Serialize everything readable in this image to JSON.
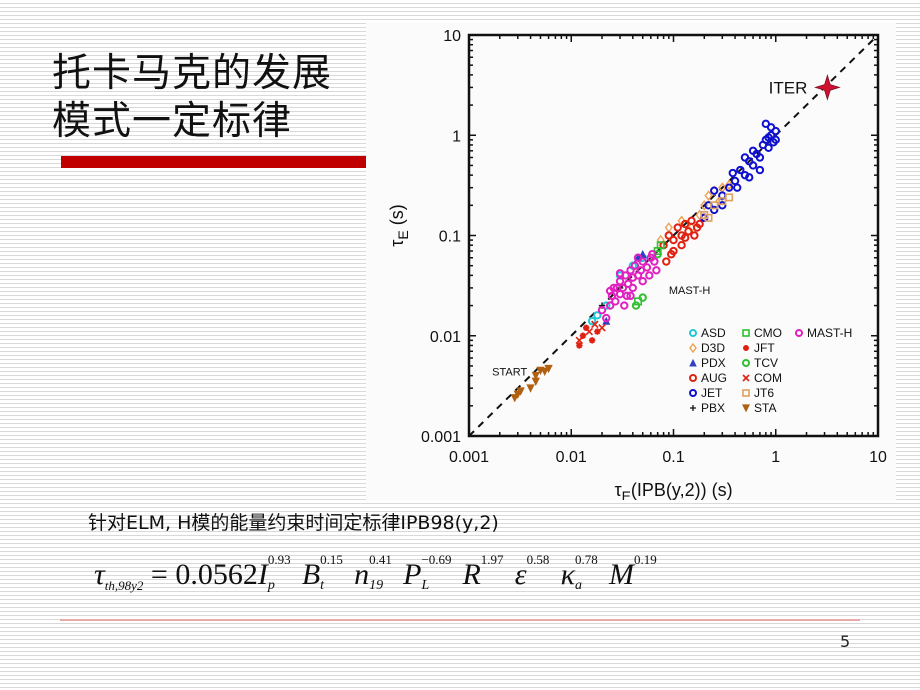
{
  "slide": {
    "title_line1": "托卡马克的发展",
    "title_line2": "模式一定标律",
    "accent_color": "#c00000",
    "subtitle": "针对ELM, H模的能量约束时间定标律IPB98(y,2)",
    "page_number": "5",
    "formula": {
      "lhs_symbol": "τ",
      "lhs_subscript": "th,98y2",
      "equals": "=",
      "coefficient": "0.0562",
      "terms": [
        {
          "base": "I",
          "sub": "p",
          "exp": "0.93"
        },
        {
          "base": "B",
          "sub": "t",
          "exp": "0.15"
        },
        {
          "base": "n",
          "sub": "19",
          "exp": "0.41"
        },
        {
          "base": "P",
          "sub": "L",
          "exp": "−0.69"
        },
        {
          "base": "R",
          "sub": "",
          "exp": "1.97"
        },
        {
          "base": "ε",
          "sub": "",
          "exp": "0.58"
        },
        {
          "base": "κ",
          "sub": "a",
          "exp": "0.78"
        },
        {
          "base": "M",
          "sub": "",
          "exp": "0.19"
        }
      ]
    }
  },
  "chart_data": {
    "type": "scatter",
    "title": "",
    "xlabel": "τE(IPB(y,2)) (s)",
    "ylabel": "τE (s)",
    "xscale": "log",
    "yscale": "log",
    "xlim": [
      0.001,
      10
    ],
    "ylim": [
      0.001,
      10
    ],
    "x_ticks": [
      "0.001",
      "0.01",
      "0.1",
      "1",
      "10"
    ],
    "y_ticks": [
      "0.001",
      "0.01",
      "0.1",
      "1",
      "10"
    ],
    "grid": false,
    "reference_line": {
      "style": "dashed",
      "equation": "y = x",
      "color": "#111111"
    },
    "legend_position": "bottom-right",
    "annotations": [
      {
        "text": "ITER",
        "x": 3.2,
        "y": 3.0
      },
      {
        "text": "MAST-H",
        "x": 0.09,
        "y": 0.026
      },
      {
        "text": "START",
        "x": 0.0025,
        "y": 0.004
      }
    ],
    "series": [
      {
        "name": "ASD",
        "color": "#22c8d8",
        "marker": "circle",
        "points": [
          [
            0.016,
            0.014
          ],
          [
            0.018,
            0.016
          ],
          [
            0.03,
            0.04
          ],
          [
            0.04,
            0.05
          ],
          [
            0.05,
            0.06
          ],
          [
            0.022,
            0.02
          ]
        ]
      },
      {
        "name": "D3D",
        "color": "#f0a050",
        "marker": "diamond",
        "points": [
          [
            0.075,
            0.09
          ],
          [
            0.09,
            0.12
          ],
          [
            0.12,
            0.14
          ],
          [
            0.15,
            0.12
          ],
          [
            0.2,
            0.2
          ],
          [
            0.25,
            0.28
          ],
          [
            0.3,
            0.3
          ],
          [
            0.35,
            0.32
          ],
          [
            0.18,
            0.16
          ],
          [
            0.22,
            0.25
          ],
          [
            0.28,
            0.22
          ]
        ]
      },
      {
        "name": "PDX",
        "color": "#3040c0",
        "marker": "triangle",
        "points": [
          [
            0.045,
            0.06
          ],
          [
            0.05,
            0.065
          ],
          [
            0.022,
            0.014
          ]
        ]
      },
      {
        "name": "AUG",
        "color": "#e02010",
        "marker": "circle",
        "points": [
          [
            0.08,
            0.08
          ],
          [
            0.09,
            0.1
          ],
          [
            0.1,
            0.09
          ],
          [
            0.11,
            0.12
          ],
          [
            0.12,
            0.1
          ],
          [
            0.13,
            0.13
          ],
          [
            0.14,
            0.11
          ],
          [
            0.15,
            0.14
          ],
          [
            0.17,
            0.12
          ],
          [
            0.1,
            0.07
          ],
          [
            0.12,
            0.08
          ],
          [
            0.16,
            0.1
          ],
          [
            0.2,
            0.15
          ],
          [
            0.085,
            0.055
          ],
          [
            0.095,
            0.065
          ],
          [
            0.13,
            0.095
          ],
          [
            0.18,
            0.13
          ]
        ]
      },
      {
        "name": "JET",
        "color": "#1010d0",
        "marker": "circle",
        "points": [
          [
            0.2,
            0.15
          ],
          [
            0.22,
            0.2
          ],
          [
            0.25,
            0.18
          ],
          [
            0.3,
            0.25
          ],
          [
            0.35,
            0.3
          ],
          [
            0.4,
            0.35
          ],
          [
            0.45,
            0.45
          ],
          [
            0.5,
            0.4
          ],
          [
            0.55,
            0.55
          ],
          [
            0.6,
            0.5
          ],
          [
            0.65,
            0.65
          ],
          [
            0.7,
            0.6
          ],
          [
            0.75,
            0.8
          ],
          [
            0.8,
            0.9
          ],
          [
            0.85,
            0.75
          ],
          [
            0.9,
            1.0
          ],
          [
            0.95,
            0.85
          ],
          [
            1.0,
            1.1
          ],
          [
            0.9,
            1.2
          ],
          [
            0.8,
            1.3
          ],
          [
            0.3,
            0.2
          ],
          [
            0.42,
            0.3
          ],
          [
            0.5,
            0.6
          ],
          [
            0.6,
            0.7
          ],
          [
            0.7,
            0.45
          ],
          [
            0.25,
            0.28
          ],
          [
            0.38,
            0.42
          ],
          [
            0.85,
            0.95
          ],
          [
            1.0,
            0.9
          ],
          [
            0.55,
            0.38
          ]
        ]
      },
      {
        "name": "PBX",
        "color": "#111111",
        "marker": "plus",
        "points": [
          [
            0.02,
            0.02
          ],
          [
            0.03,
            0.03
          ]
        ]
      },
      {
        "name": "CMO",
        "color": "#30c030",
        "marker": "square",
        "points": [
          [
            0.07,
            0.07
          ],
          [
            0.075,
            0.08
          ],
          [
            0.045,
            0.022
          ]
        ]
      },
      {
        "name": "JFT",
        "color": "#e02010",
        "marker": "asterisk",
        "points": [
          [
            0.012,
            0.008
          ],
          [
            0.013,
            0.01
          ],
          [
            0.014,
            0.012
          ],
          [
            0.016,
            0.009
          ],
          [
            0.018,
            0.011
          ]
        ]
      },
      {
        "name": "TCV",
        "color": "#30c030",
        "marker": "circle",
        "points": [
          [
            0.043,
            0.02
          ],
          [
            0.05,
            0.024
          ],
          [
            0.07,
            0.065
          ]
        ]
      },
      {
        "name": "COM",
        "color": "#e02010",
        "marker": "x",
        "points": [
          [
            0.012,
            0.009
          ],
          [
            0.015,
            0.011
          ],
          [
            0.02,
            0.012
          ],
          [
            0.017,
            0.013
          ]
        ]
      },
      {
        "name": "JT6",
        "color": "#e0a060",
        "marker": "square",
        "points": [
          [
            0.2,
            0.16
          ],
          [
            0.25,
            0.2
          ],
          [
            0.3,
            0.22
          ],
          [
            0.35,
            0.24
          ],
          [
            0.22,
            0.15
          ]
        ]
      },
      {
        "name": "STA",
        "color": "#b06010",
        "marker": "triangle-down",
        "points": [
          [
            0.0028,
            0.0024
          ],
          [
            0.003,
            0.0026
          ],
          [
            0.0032,
            0.0028
          ],
          [
            0.004,
            0.003
          ],
          [
            0.0045,
            0.0035
          ],
          [
            0.005,
            0.0045
          ],
          [
            0.0055,
            0.0044
          ],
          [
            0.006,
            0.0047
          ],
          [
            0.0045,
            0.004
          ]
        ]
      },
      {
        "name": "MAST-H",
        "color": "#e020c0",
        "marker": "circle",
        "points": [
          [
            0.02,
            0.018
          ],
          [
            0.022,
            0.015
          ],
          [
            0.024,
            0.02
          ],
          [
            0.025,
            0.025
          ],
          [
            0.027,
            0.022
          ],
          [
            0.028,
            0.03
          ],
          [
            0.03,
            0.026
          ],
          [
            0.03,
            0.035
          ],
          [
            0.032,
            0.03
          ],
          [
            0.034,
            0.04
          ],
          [
            0.035,
            0.025
          ],
          [
            0.036,
            0.033
          ],
          [
            0.038,
            0.045
          ],
          [
            0.04,
            0.03
          ],
          [
            0.04,
            0.038
          ],
          [
            0.042,
            0.05
          ],
          [
            0.045,
            0.04
          ],
          [
            0.048,
            0.045
          ],
          [
            0.05,
            0.055
          ],
          [
            0.055,
            0.048
          ],
          [
            0.06,
            0.06
          ],
          [
            0.065,
            0.055
          ],
          [
            0.068,
            0.045
          ],
          [
            0.05,
            0.035
          ],
          [
            0.033,
            0.02
          ],
          [
            0.026,
            0.03
          ],
          [
            0.038,
            0.025
          ],
          [
            0.058,
            0.04
          ],
          [
            0.062,
            0.065
          ],
          [
            0.045,
            0.06
          ],
          [
            0.03,
            0.042
          ],
          [
            0.024,
            0.028
          ]
        ]
      },
      {
        "name": "ITER",
        "color": "#d01030",
        "marker": "star",
        "points": [
          [
            3.2,
            3.0
          ]
        ],
        "show_in_legend": false
      }
    ],
    "legend_entries": [
      "ASD",
      "D3D",
      "PDX",
      "AUG",
      "JET",
      "PBX",
      "CMO",
      "JFT",
      "TCV",
      "COM",
      "JT6",
      "STA",
      "MAST-H"
    ]
  }
}
